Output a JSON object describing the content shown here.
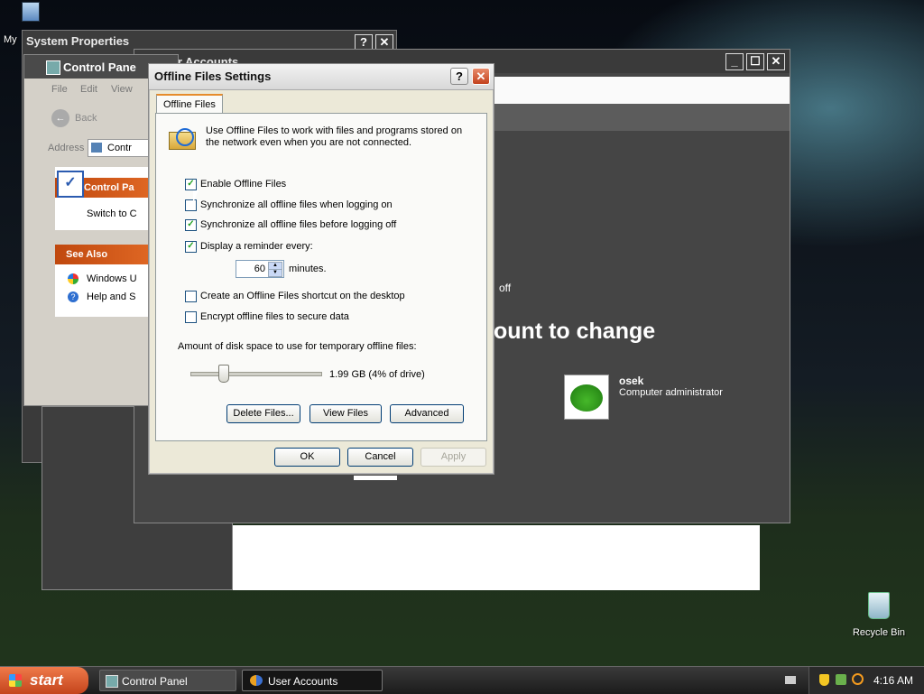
{
  "desktop": {
    "my_computer_label": "My",
    "recycle_bin_label": "Recycle Bin"
  },
  "system_properties": {
    "title": "System Properties"
  },
  "control_panel": {
    "title": "Control Pane",
    "menu": [
      "File",
      "Edit",
      "View"
    ],
    "back_label": "Back",
    "address_label": "Address",
    "address_value": "Contr",
    "panel_title": "Control Pa",
    "switch_label": "Switch to C",
    "see_also_title": "See Also",
    "see_also_items": [
      "Windows U",
      "Help and S"
    ]
  },
  "user_accounts": {
    "title": "User Accounts",
    "text_off": "off",
    "heading": "ount to change",
    "account_name": "osek",
    "account_role": "Computer administrator"
  },
  "dialog": {
    "title": "Offline Files Settings",
    "help_label": "?",
    "close_label": "✕",
    "tab_label": "Offline Files",
    "description": "Use Offline Files to work with files and programs stored on the network even when you are not connected.",
    "options": {
      "enable": {
        "label": "Enable Offline Files",
        "checked": true
      },
      "sync_logon": {
        "label": "Synchronize all offline files when logging on",
        "checked": false
      },
      "sync_logoff": {
        "label": "Synchronize all offline files before logging off",
        "checked": true
      },
      "reminder": {
        "label": "Display a reminder every:",
        "checked": true
      },
      "shortcut": {
        "label": "Create an Offline Files shortcut on the desktop",
        "checked": false
      },
      "encrypt": {
        "label": "Encrypt offline files to secure data",
        "checked": false
      }
    },
    "reminder_minutes": "60",
    "minutes_label": "minutes.",
    "disk_space_label": "Amount of disk space to use for temporary offline files:",
    "disk_space_value": "1.99 GB (4% of drive)",
    "slider_fraction": 0.04,
    "buttons": {
      "delete_files": "Delete Files...",
      "view_files": "View Files",
      "advanced": "Advanced",
      "ok": "OK",
      "cancel": "Cancel",
      "apply": "Apply"
    }
  },
  "taskbar": {
    "start_label": "start",
    "tasks": [
      "Control Panel",
      "User Accounts"
    ],
    "clock": "4:16 AM"
  },
  "colors": {
    "check": "#21a121",
    "tab_accent": "#e68b2c",
    "start": "#d94f1d"
  }
}
